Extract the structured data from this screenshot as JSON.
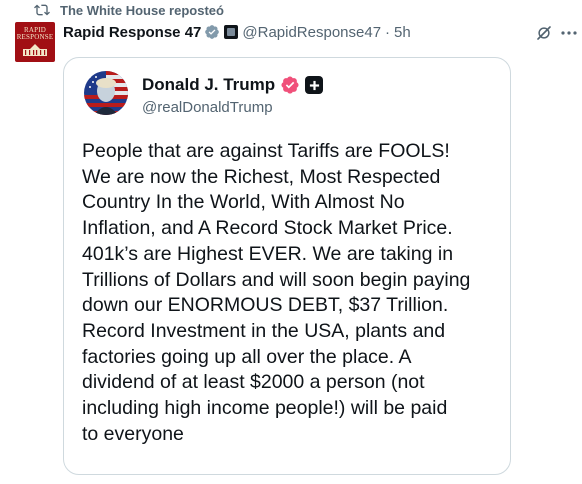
{
  "repost": {
    "text": "The White House reposteó",
    "icon": "repost-icon"
  },
  "author": {
    "avatar_text_line1": "RAPID",
    "avatar_text_line2": "RESPONSE",
    "name": "Rapid Response 47",
    "verified_icon": "verified-badge-icon",
    "affiliate_icon": "affiliate-badge-icon",
    "handle": "@RapidResponse47",
    "separator": "·",
    "time": "5h"
  },
  "actions": {
    "grok_icon": "grok-icon",
    "more_icon": "more-options-icon"
  },
  "quoted": {
    "name": "Donald J. Trump",
    "verified_icon": "verified-badge-icon",
    "plus_icon": "plus-badge-icon",
    "handle": "@realDonaldTrump",
    "text": "People that are against Tariffs are FOOLS!\nWe are now the Richest, Most Respected\nCountry In the World, With Almost No\nInflation, and A Record Stock Market Price.\n401k’s are Highest EVER. We are taking in\nTrillions of Dollars and will soon begin paying\ndown our ENORMOUS DEBT, $37 Trillion.\nRecord Investment in the USA, plants and\nfactories going up all over the place. A\ndividend of at least $2000 a person (not\nincluding high income people!) will be paid\nto everyone"
  },
  "colors": {
    "text_primary": "#0f1419",
    "text_secondary": "#536471",
    "border": "#cfd9de",
    "verified_blue": "#1d9bf0",
    "verified_pink": "#f0507a",
    "rr_red": "#a10f14"
  }
}
